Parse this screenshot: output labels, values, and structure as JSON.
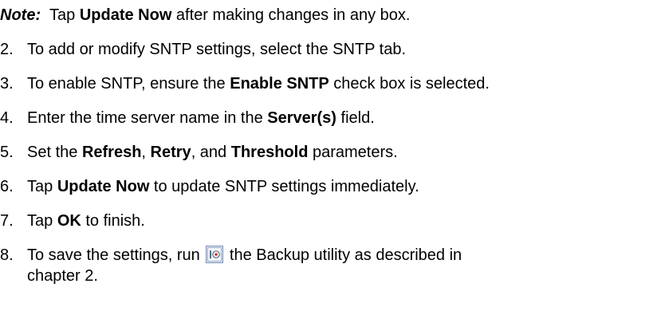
{
  "note": {
    "label": "Note:",
    "text_before": "Tap ",
    "bold": "Update Now",
    "text_after": " after making changes in any box."
  },
  "steps": [
    {
      "number": "2.",
      "parts": [
        "To add or modify SNTP settings, select the SNTP tab."
      ]
    },
    {
      "number": "3.",
      "parts": [
        "To enable SNTP, ensure the ",
        "Enable SNTP",
        " check box is selected."
      ]
    },
    {
      "number": "4.",
      "parts": [
        "Enter the time server name in the ",
        "Server(s)",
        " field."
      ]
    },
    {
      "number": "5.",
      "parts": [
        "Set the ",
        "Refresh",
        ", ",
        "Retry",
        ", and ",
        "Threshold",
        " parameters."
      ]
    },
    {
      "number": "6.",
      "parts": [
        "Tap ",
        "Update Now",
        " to update SNTP settings immediately."
      ]
    },
    {
      "number": "7.",
      "parts": [
        "Tap ",
        "OK",
        " to finish."
      ]
    },
    {
      "number": "8.",
      "text_before_icon": "To save the settings, run ",
      "icon": "backup-utility-icon",
      "text_after_icon": " the Backup utility as described in",
      "line2": "chapter 2."
    }
  ],
  "colors": {
    "text": "#000000",
    "icon_border": "#7a8fb0",
    "icon_fill": "#dfe8f5",
    "icon_accent": "#c0392b"
  }
}
